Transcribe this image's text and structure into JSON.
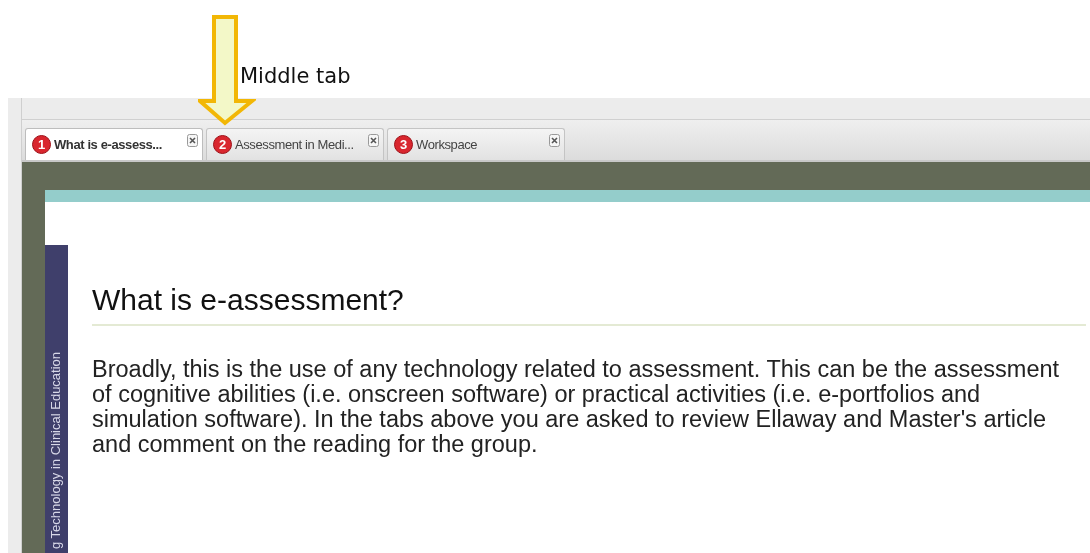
{
  "annotation": {
    "text": "Middle tab"
  },
  "tabs": [
    {
      "number": "1",
      "label": "What is e-assess...",
      "selected": true
    },
    {
      "number": "2",
      "label": "Assessment in Medi...",
      "selected": false
    },
    {
      "number": "3",
      "label": "Workspace",
      "selected": false
    }
  ],
  "side_banner": {
    "text": "g Technology in Clinical Education"
  },
  "page": {
    "heading": "What is e-assessment?",
    "paragraph": "Broadly, this is the use of any technology related to assessment. This can be the assessment of cognitive abilities (i.e. onscreen software) or practical activities (i.e. e-portfolios and simulation software). In the tabs above you are asked to review Ellaway and Master's article and comment on the reading for the group."
  }
}
